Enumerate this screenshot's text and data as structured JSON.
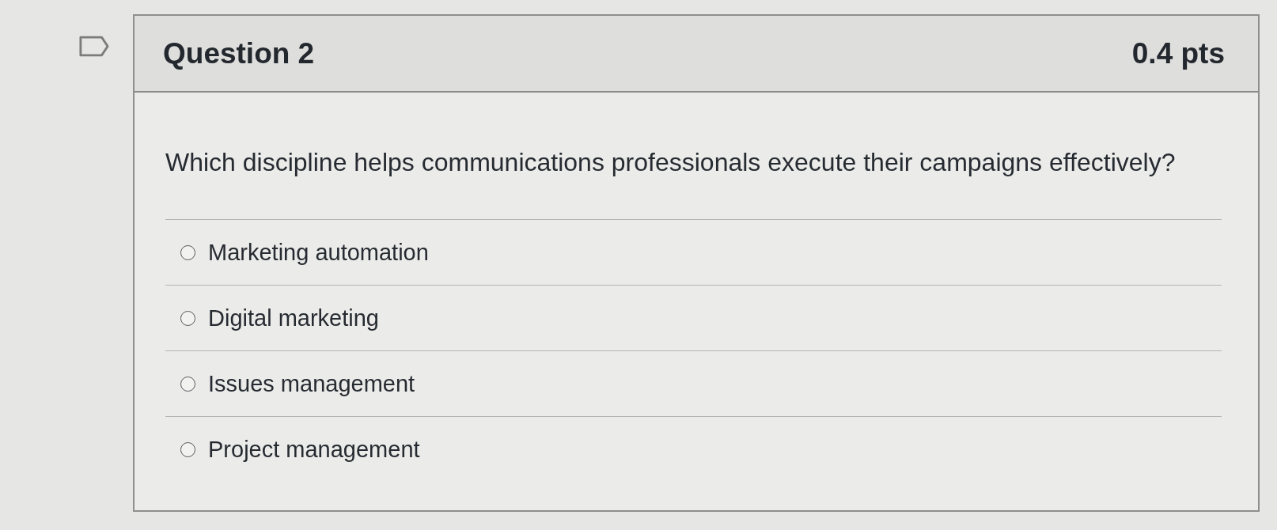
{
  "question": {
    "flagged": false,
    "title": "Question 2",
    "points": "0.4 pts",
    "text": "Which discipline helps communications professionals execute their campaigns effectively?"
  },
  "answers": [
    {
      "label": "Marketing automation",
      "selected": false
    },
    {
      "label": "Digital marketing",
      "selected": false
    },
    {
      "label": "Issues management",
      "selected": false
    },
    {
      "label": "Project management",
      "selected": false
    }
  ]
}
